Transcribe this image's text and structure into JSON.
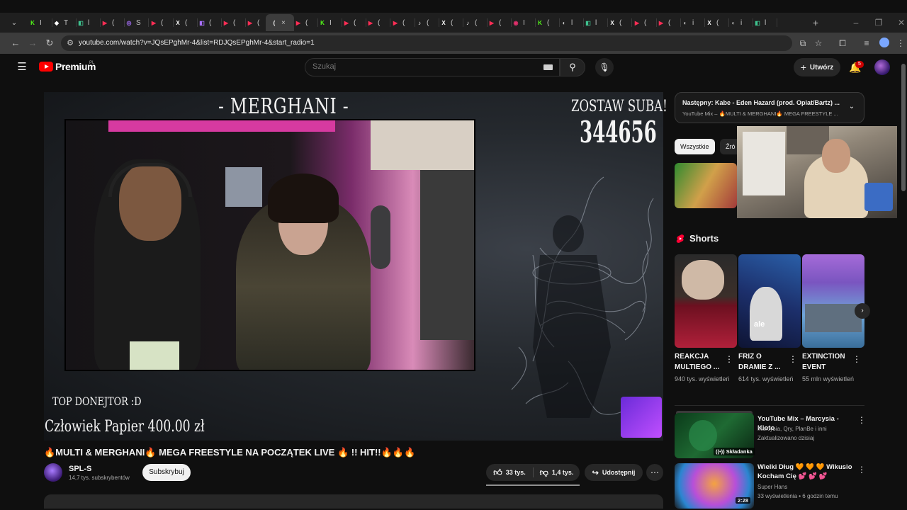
{
  "tabs": [
    {
      "fav": "K",
      "color": "#53fc18",
      "text": "I"
    },
    {
      "fav": "◆",
      "color": "#ffffff",
      "text": "T"
    },
    {
      "fav": "◧",
      "color": "#3ec28f",
      "text": "l"
    },
    {
      "fav": "▶",
      "color": "#ff2d55",
      "text": "("
    },
    {
      "fav": "◎",
      "color": "#a970ff",
      "text": "S"
    },
    {
      "fav": "▶",
      "color": "#ff2d55",
      "text": "("
    },
    {
      "fav": "X",
      "color": "#ffffff",
      "text": "("
    },
    {
      "fav": "◧",
      "color": "#a970ff",
      "text": "("
    },
    {
      "fav": "▶",
      "color": "#ff2d55",
      "text": "("
    },
    {
      "fav": "▶",
      "color": "#ff2d55",
      "text": "("
    },
    {
      "fav": "(",
      "color": "#ffffff",
      "text": "×",
      "active": true
    },
    {
      "fav": "▶",
      "color": "#ff2d55",
      "text": "("
    },
    {
      "fav": "K",
      "color": "#53fc18",
      "text": "I"
    },
    {
      "fav": "▶",
      "color": "#ff2d55",
      "text": "("
    },
    {
      "fav": "▶",
      "color": "#ff2d55",
      "text": "("
    },
    {
      "fav": "▶",
      "color": "#ff2d55",
      "text": "("
    },
    {
      "fav": "♪",
      "color": "#ffffff",
      "text": "("
    },
    {
      "fav": "X",
      "color": "#ffffff",
      "text": "("
    },
    {
      "fav": "♪",
      "color": "#ffffff",
      "text": "("
    },
    {
      "fav": "▶",
      "color": "#ff2d55",
      "text": "("
    },
    {
      "fav": "◉",
      "color": "#e1306c",
      "text": "I"
    },
    {
      "fav": "K",
      "color": "#53fc18",
      "text": "("
    },
    {
      "fav": "◐",
      "color": "#c7c7c7",
      "text": "l"
    },
    {
      "fav": "◧",
      "color": "#3ec28f",
      "text": "l"
    },
    {
      "fav": "X",
      "color": "#ffffff",
      "text": "("
    },
    {
      "fav": "▶",
      "color": "#ff2d55",
      "text": "("
    },
    {
      "fav": "▶",
      "color": "#ff2d55",
      "text": "("
    },
    {
      "fav": "◐",
      "color": "#c7c7c7",
      "text": "i"
    },
    {
      "fav": "X",
      "color": "#ffffff",
      "text": "("
    },
    {
      "fav": "◐",
      "color": "#c7c7c7",
      "text": "i"
    },
    {
      "fav": "◧",
      "color": "#3ec28f",
      "text": "l"
    }
  ],
  "browser": {
    "url": "youtube.com/watch?v=JQsEPghMr-4&list=RDJQsEPghMr-4&start_radio=1"
  },
  "masthead": {
    "logo_text": "Premium",
    "logo_country": "PL",
    "search_placeholder": "Szukaj",
    "create_label": "Utwórz",
    "notification_count": "5"
  },
  "video": {
    "overlay_title": "- MERGHANI -",
    "overlay_sub_label": "ZOSTAW SUBA!",
    "overlay_sub_count": "344656",
    "overlay_donor_label": "TOP DONEJTOR :D",
    "overlay_donor": "Człowiek Papier 400.00 zł",
    "title": "🔥MULTI & MERGHANI🔥 MEGA FREESTYLE NA POCZĄTEK LIVE 🔥 !! HIT!!🔥🔥🔥",
    "channel_name": "SPL-S",
    "channel_subs": "14,7 tys. subskrybentów",
    "subscribe_label": "Subskrybuj",
    "likes": "33 tys.",
    "dislikes": "1,4 tys.",
    "share_label": "Udostępnij"
  },
  "sidebar": {
    "next_title": "Następny: Kabe - Eden Hazard (prod. Opiat/Bartz) ...",
    "next_sub": "YouTube Mix – 🔥MULTI & MERGHANI🔥 MEGA FREESTYLE ...",
    "chip_all": "Wszystkie",
    "chip_src": "Źró",
    "shorts_label": "Shorts",
    "shorts": [
      {
        "title": "REAKCJA MULTIEGO ...",
        "views": "940 tys. wyświetleń"
      },
      {
        "title": "FRIZ O DRAMIE Z ...",
        "views": "614 tys. wyświetleń",
        "caption": "ale"
      },
      {
        "title": "EXTINCTION EVENT",
        "views": "55 mln wyświetleń"
      }
    ],
    "recs": [
      {
        "title": "YouTube Mix – Marcysia - Kioto",
        "line1": "Marcysia, Qry, PlanBe i inni",
        "line2": "Zaktualizowano dzisiaj",
        "badge": "((•)) Składanka"
      },
      {
        "title": "Wielki Dług 🧡 🧡 🧡 Wikusio Kocham Cię 💕 💕 💕",
        "line1": "Super Hans",
        "line2": "33 wyświetlenia • 6 godzin temu",
        "duration": "2:28"
      }
    ]
  },
  "colors": {
    "accent_red": "#ff0000",
    "kick_green": "#53fc18",
    "badge_red": "#cc0000"
  }
}
